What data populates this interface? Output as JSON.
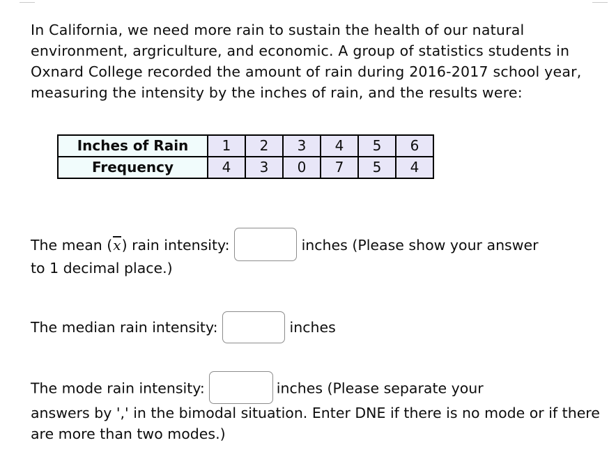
{
  "document": {
    "prompt": "In California, we need more rain to sustain the health of our natural environment, argriculture, and economic. A group of statistics students in Oxnard College recorded the amount of rain during 2016-2017 school year, measuring the intensity by the inches of rain, and the results were:"
  },
  "table": {
    "row_labels": [
      "Inches of Rain",
      "Frequency"
    ],
    "inches_of_rain": [
      "1",
      "2",
      "3",
      "4",
      "5",
      "6"
    ],
    "frequency": [
      "4",
      "3",
      "0",
      "7",
      "5",
      "4"
    ],
    "label_cell_color": "#f1fcfc",
    "data_cell_color": "#e8e6f8",
    "border_color": "#000000"
  },
  "questions": {
    "mean": {
      "label_before": "The mean (",
      "symbol": "x̄",
      "label_after": ") rain intensity:",
      "value": "",
      "placeholder": "",
      "unit_and_note": "inches (Please show your answer",
      "note_continued": "to 1 decimal place.)"
    },
    "median": {
      "label": "The median rain intensity:",
      "value": "",
      "placeholder": "",
      "unit": "inches"
    },
    "mode": {
      "label": "The mode rain intensity:",
      "value": "",
      "placeholder": "",
      "unit_and_note": "inches (Please separate your",
      "note_continued": "answers by ',' in the bimodal situation. Enter DNE if there is no mode or if there are more than two modes.)"
    }
  },
  "style": {
    "input_border_color": "#8c8c8c",
    "text_color": "#0d0d0d",
    "background": "#ffffff"
  }
}
